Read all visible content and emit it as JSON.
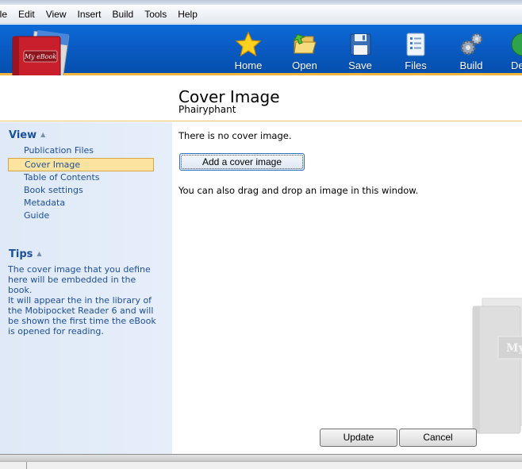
{
  "menu": [
    "ile",
    "Edit",
    "View",
    "Insert",
    "Build",
    "Tools",
    "Help"
  ],
  "toolbar": {
    "home": "Home",
    "open": "Open",
    "save": "Save",
    "files": "Files",
    "build": "Build",
    "partial": "De"
  },
  "logo": {
    "text": "My eBook"
  },
  "header": {
    "title": "Cover Image",
    "subtitle": "Phairyphant"
  },
  "sidebar": {
    "view_heading": "View",
    "items": [
      "Publication Files",
      "Cover Image",
      "Table of Contents",
      "Book settings",
      "Metadata",
      "Guide"
    ],
    "selected_index": 1,
    "tips_heading": "Tips",
    "tips_text": "The cover image that you define here will be embedded in the book.\nIt will appear the in the library of the Mobipocket Reader 6 and will be shown the first time the eBook is opened for reading."
  },
  "content": {
    "no_cover": "There is no cover image.",
    "add_button": "Add a cover image",
    "drag_hint": "You can also drag and drop an image in this window.",
    "watermark_text": "My"
  },
  "dialog": {
    "update": "Update",
    "cancel": "Cancel"
  },
  "colors": {
    "toolbar_blue": "#0a5cc4",
    "accent_orange": "#f0b53a",
    "sidebar_bg": "#dfe9f7",
    "link_blue": "#1e4f96",
    "selection": "#fde3a0"
  }
}
